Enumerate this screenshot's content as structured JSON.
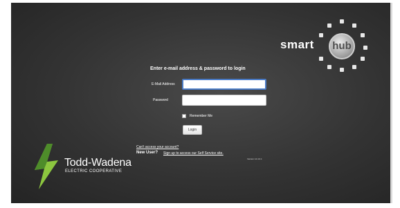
{
  "logo": {
    "smart": "smart",
    "hub": "hub"
  },
  "form": {
    "heading": "Enter e-mail address & password to login",
    "email_label": "E-Mail Address",
    "email_value": "",
    "password_label": "Password",
    "password_value": "",
    "remember_label": "Remember Me",
    "remember_checked": false,
    "login_label": "Login"
  },
  "links": {
    "cant_access": "Can't access your account?",
    "new_user": "New User?",
    "sign_up": "Sign up to access our Self Service site."
  },
  "version": "Version 14.4.0.1",
  "brand": {
    "name": "Todd-Wadena",
    "subtitle": "ELECTRIC COOPERATIVE"
  },
  "colors": {
    "bolt_light": "#8cc63f",
    "bolt_dark": "#4e8c2a",
    "focus": "#4a7bc6"
  }
}
